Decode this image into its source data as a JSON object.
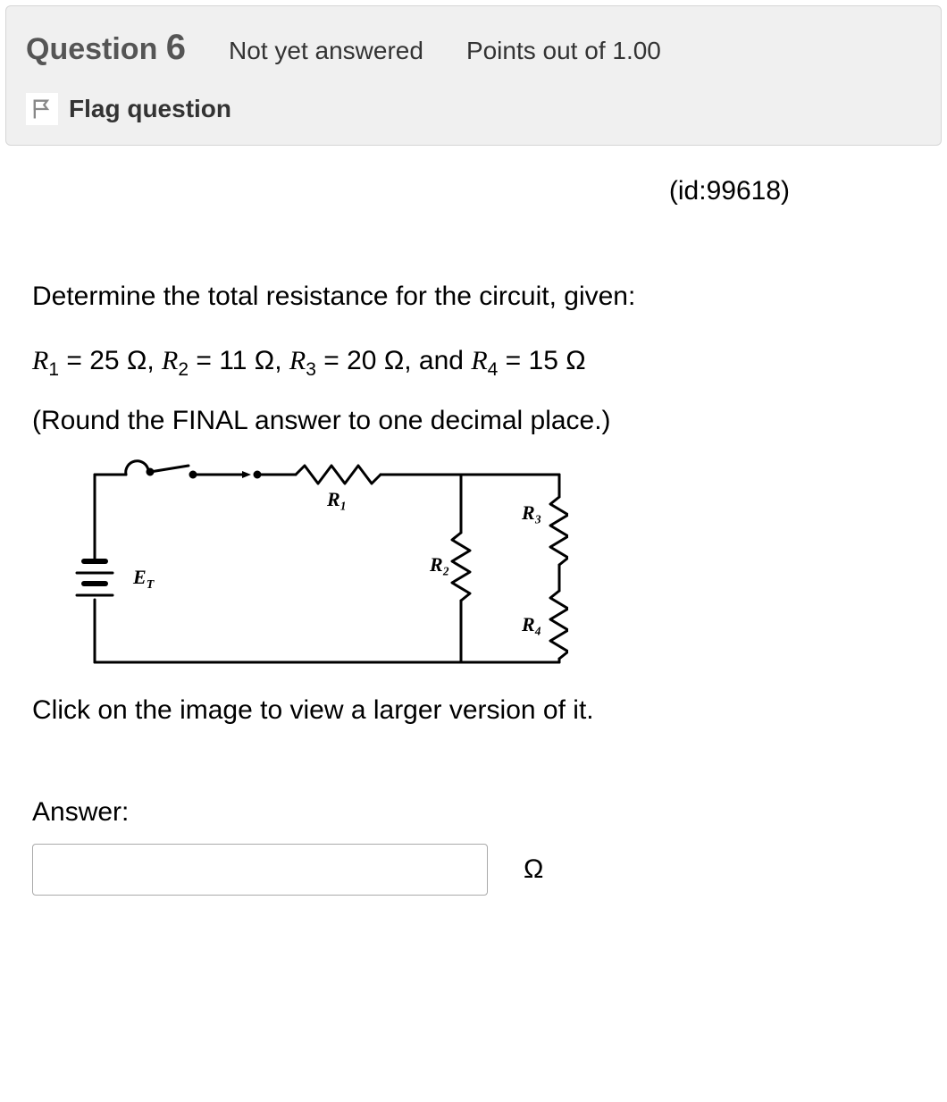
{
  "header": {
    "question_label": "Question",
    "question_number": "6",
    "status": "Not yet answered",
    "points": "Points out of 1.00",
    "flag_label": "Flag question"
  },
  "content": {
    "id_text": "(id:99618)",
    "prompt": "Determine the total resistance for the circuit, given:",
    "R1": {
      "name": "R",
      "sub": "1",
      "value": "25",
      "unit": "Ω"
    },
    "R2": {
      "name": "R",
      "sub": "2",
      "value": "11",
      "unit": "Ω"
    },
    "R3": {
      "name": "R",
      "sub": "3",
      "value": "20",
      "unit": "Ω"
    },
    "R4": {
      "name": "R",
      "sub": "4",
      "value": "15",
      "unit": "Ω"
    },
    "given_and": "and",
    "round_note": "(Round the FINAL answer to one decimal place.)",
    "click_note": "Click on the image to view a larger version of it.",
    "answer_label": "Answer:",
    "answer_unit": "Ω",
    "answer_value": ""
  },
  "circuit": {
    "source_label": "E",
    "source_sub": "T",
    "r1_label": "R₁",
    "r2_label": "R₂",
    "r3_label": "R₃",
    "r4_label": "R₄"
  }
}
